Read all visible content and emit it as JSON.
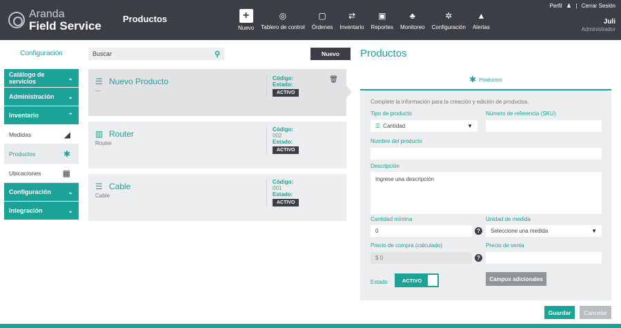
{
  "brand": {
    "line1": "Aranda",
    "line2": "Field Service"
  },
  "header": {
    "section_title": "Productos",
    "nav": [
      {
        "label": "Nuevo",
        "icon": "plus-icon"
      },
      {
        "label": "Tablero de control",
        "icon": "dashboard-icon"
      },
      {
        "label": "Órdenes",
        "icon": "orders-icon"
      },
      {
        "label": "Inventario",
        "icon": "inventory-icon"
      },
      {
        "label": "Reportes",
        "icon": "reports-icon"
      },
      {
        "label": "Monitoreo",
        "icon": "monitoring-icon"
      },
      {
        "label": "Configuración",
        "icon": "gear-icon"
      },
      {
        "label": "Alertas",
        "icon": "bell-icon"
      }
    ],
    "user": {
      "profile_link": "Perfil",
      "logout_link": "Cerrar Sesión",
      "separator": "|",
      "name": "Juli",
      "role": "Administrador"
    }
  },
  "sidebar": {
    "heading": "Configuración",
    "groups": [
      {
        "label": "Catálogo de servicios"
      },
      {
        "label": "Administración"
      },
      {
        "label": "Inventario"
      },
      {
        "label": "Configuración"
      },
      {
        "label": "Integración"
      }
    ],
    "inventory_items": [
      {
        "label": "Medidas",
        "icon": "ruler-icon"
      },
      {
        "label": "Productos",
        "icon": "products-icon"
      },
      {
        "label": "Ubicaciones",
        "icon": "warehouse-icon"
      }
    ]
  },
  "list": {
    "search_placeholder": "Buscar",
    "new_button": "Nuevo",
    "code_label": "Código:",
    "state_label": "Estado:",
    "items": [
      {
        "name": "Nuevo Producto",
        "subtitle": "---",
        "code": "",
        "status": "ACTIVO"
      },
      {
        "name": "Router",
        "subtitle": "Router",
        "code": "002",
        "status": "ACTIVO"
      },
      {
        "name": "Cable",
        "subtitle": "Cable",
        "code": "001",
        "status": "ACTIVO"
      }
    ]
  },
  "detail": {
    "title": "Productos",
    "tab_label": "Productos",
    "description": "Complete la información para la creación y edición de productos.",
    "fields": {
      "product_type": {
        "label": "Tipo de producto",
        "value": "Cantidad"
      },
      "sku": {
        "label": "Número de referencia (SKU)",
        "value": ""
      },
      "product_name": {
        "label": "Nombre del producto",
        "value": ""
      },
      "description": {
        "label": "Descripción",
        "placeholder": "Ingrese una descripción"
      },
      "min_quantity": {
        "label": "Cantidad mínima",
        "value": "0"
      },
      "unit": {
        "label": "Unidad de medida",
        "value": "Seleccione una medida"
      },
      "purchase_price": {
        "label": "Precio de compra (calculado)",
        "value": "$ 0"
      },
      "sale_price": {
        "label": "Precio de venta",
        "value": ""
      },
      "state": {
        "label": "Estado",
        "value": "ACTIVO"
      }
    },
    "extra_fields_button": "Campos adicionales",
    "help_glyph": "?"
  },
  "footer": {
    "save_button": "Guardar",
    "cancel_button": "Cancelar"
  },
  "colors": {
    "accent": "#1aa396",
    "topbar": "#3b3f45",
    "panel": "#eceeef"
  }
}
